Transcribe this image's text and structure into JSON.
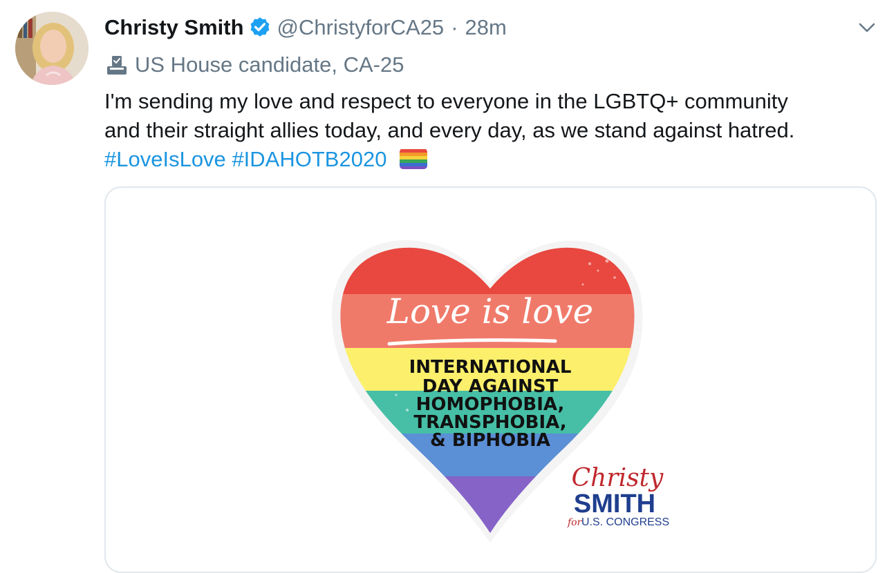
{
  "tweet": {
    "author_name": "Christy Smith",
    "handle": "@ChristyforCA25",
    "separator": "·",
    "time": "28m",
    "label_text": "US House candidate, CA-25",
    "text_line1": "I'm sending my love and respect to everyone in the LGBTQ+ community",
    "text_line2": "and their straight allies today, and every day, as we stand against hatred.",
    "hashtags": [
      "#LoveIsLove",
      "#IDAHOTB2020"
    ],
    "emoji": "rainbow-flag"
  },
  "media": {
    "script_title": "Love is love",
    "headline_lines": [
      "INTERNATIONAL",
      "DAY AGAINST",
      "HOMOPHOBIA,",
      "TRANSPHOBIA,",
      "& BIPHOBIA"
    ],
    "logo_script": "Christy",
    "logo_name": "SMITH",
    "logo_for": "for",
    "logo_office": "U.S. CONGRESS",
    "stripe_colors": [
      "#e8483f",
      "#f07a6a",
      "#fcef6b",
      "#46bfa6",
      "#5b8fd6",
      "#8563c7"
    ]
  },
  "colors": {
    "accent": "#1b95e0",
    "muted": "#657786",
    "verified": "#1da1f2",
    "logo_red": "#c0282d",
    "logo_blue": "#1f3e8e"
  }
}
